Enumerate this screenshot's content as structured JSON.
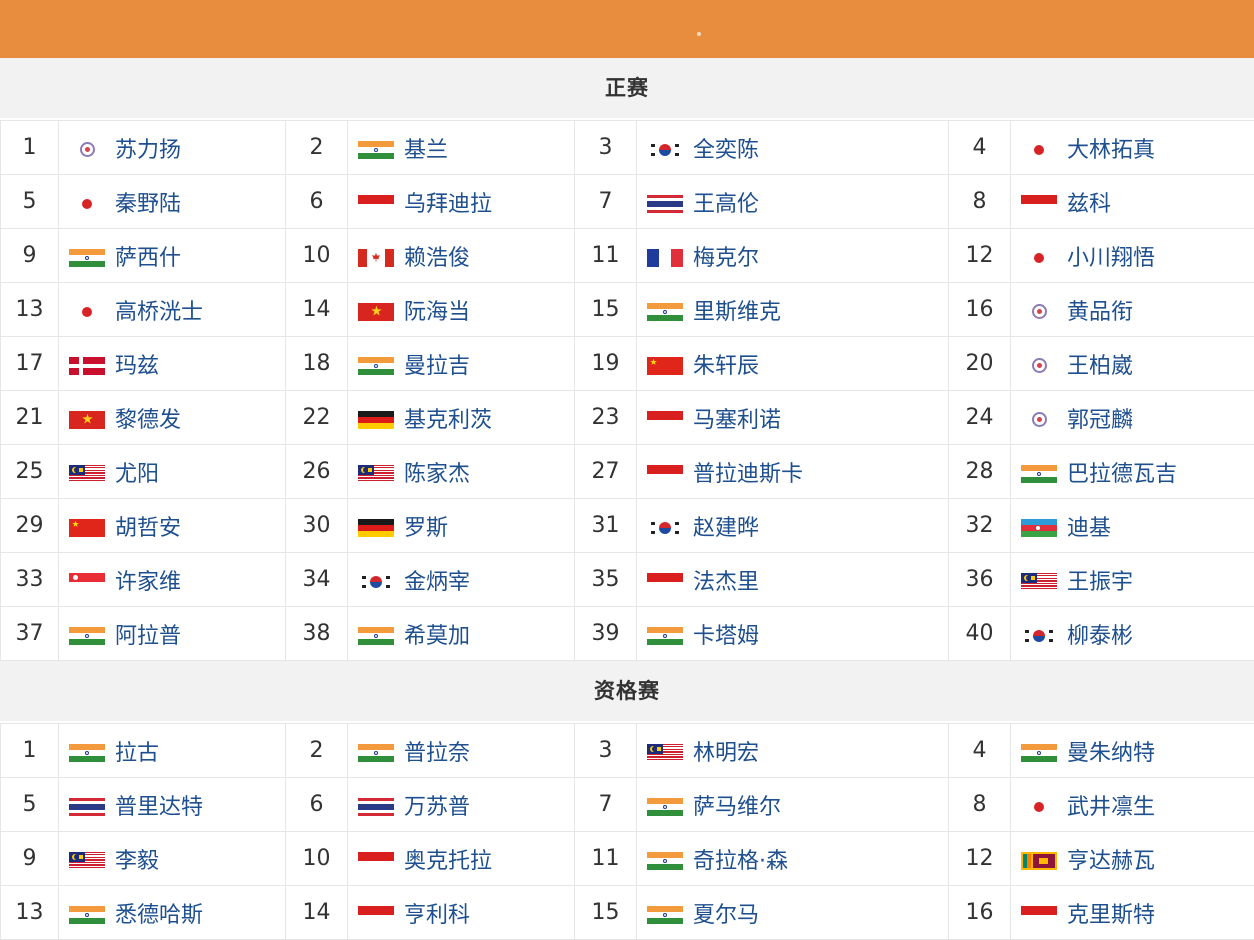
{
  "colors": {
    "header_bar": "#e88c3e",
    "section_bg": "#f2f2f2",
    "player_name": "#1e4f8f",
    "rank_text": "#333333"
  },
  "sections": {
    "main_draw": {
      "title": "正赛",
      "entries": [
        {
          "rank": "1",
          "flag": "chinese-taipei",
          "name": "苏力扬"
        },
        {
          "rank": "2",
          "flag": "india",
          "name": "基兰"
        },
        {
          "rank": "3",
          "flag": "korea",
          "name": "全奕陈"
        },
        {
          "rank": "4",
          "flag": "japan",
          "name": "大林拓真"
        },
        {
          "rank": "5",
          "flag": "japan",
          "name": "秦野陆"
        },
        {
          "rank": "6",
          "flag": "indonesia",
          "name": "乌拜迪拉"
        },
        {
          "rank": "7",
          "flag": "thailand",
          "name": "王高伦"
        },
        {
          "rank": "8",
          "flag": "indonesia",
          "name": "兹科"
        },
        {
          "rank": "9",
          "flag": "india",
          "name": "萨西什"
        },
        {
          "rank": "10",
          "flag": "canada",
          "name": "赖浩俊"
        },
        {
          "rank": "11",
          "flag": "france",
          "name": "梅克尔"
        },
        {
          "rank": "12",
          "flag": "japan",
          "name": "小川翔悟"
        },
        {
          "rank": "13",
          "flag": "japan",
          "name": "高桥洸士"
        },
        {
          "rank": "14",
          "flag": "vietnam",
          "name": "阮海当"
        },
        {
          "rank": "15",
          "flag": "india",
          "name": "里斯维克"
        },
        {
          "rank": "16",
          "flag": "chinese-taipei",
          "name": "黄品衔"
        },
        {
          "rank": "17",
          "flag": "denmark",
          "name": "玛兹"
        },
        {
          "rank": "18",
          "flag": "india",
          "name": "曼拉吉"
        },
        {
          "rank": "19",
          "flag": "china",
          "name": "朱轩辰"
        },
        {
          "rank": "20",
          "flag": "chinese-taipei",
          "name": "王柏崴"
        },
        {
          "rank": "21",
          "flag": "vietnam",
          "name": "黎德发"
        },
        {
          "rank": "22",
          "flag": "germany",
          "name": "基克利茨"
        },
        {
          "rank": "23",
          "flag": "indonesia",
          "name": "马塞利诺"
        },
        {
          "rank": "24",
          "flag": "chinese-taipei",
          "name": "郭冠麟"
        },
        {
          "rank": "25",
          "flag": "malaysia",
          "name": "尤阳"
        },
        {
          "rank": "26",
          "flag": "malaysia",
          "name": "陈家杰"
        },
        {
          "rank": "27",
          "flag": "indonesia",
          "name": "普拉迪斯卡"
        },
        {
          "rank": "28",
          "flag": "india",
          "name": "巴拉德瓦吉"
        },
        {
          "rank": "29",
          "flag": "china",
          "name": "胡哲安"
        },
        {
          "rank": "30",
          "flag": "germany",
          "name": "罗斯"
        },
        {
          "rank": "31",
          "flag": "korea",
          "name": "赵建晔"
        },
        {
          "rank": "32",
          "flag": "azerbaijan",
          "name": "迪基"
        },
        {
          "rank": "33",
          "flag": "singapore",
          "name": "许家维"
        },
        {
          "rank": "34",
          "flag": "korea",
          "name": "金炳宰"
        },
        {
          "rank": "35",
          "flag": "indonesia",
          "name": "法杰里"
        },
        {
          "rank": "36",
          "flag": "malaysia",
          "name": "王振宇"
        },
        {
          "rank": "37",
          "flag": "india",
          "name": "阿拉普"
        },
        {
          "rank": "38",
          "flag": "india",
          "name": "希莫加"
        },
        {
          "rank": "39",
          "flag": "india",
          "name": "卡塔姆"
        },
        {
          "rank": "40",
          "flag": "korea",
          "name": "柳泰彬"
        }
      ]
    },
    "qualification": {
      "title": "资格赛",
      "entries": [
        {
          "rank": "1",
          "flag": "india",
          "name": "拉古"
        },
        {
          "rank": "2",
          "flag": "india",
          "name": "普拉奈"
        },
        {
          "rank": "3",
          "flag": "malaysia",
          "name": "林明宏"
        },
        {
          "rank": "4",
          "flag": "india",
          "name": "曼朱纳特"
        },
        {
          "rank": "5",
          "flag": "thailand",
          "name": "普里达特"
        },
        {
          "rank": "6",
          "flag": "thailand",
          "name": "万苏普"
        },
        {
          "rank": "7",
          "flag": "india",
          "name": "萨马维尔"
        },
        {
          "rank": "8",
          "flag": "japan",
          "name": "武井凛生"
        },
        {
          "rank": "9",
          "flag": "malaysia",
          "name": "李毅"
        },
        {
          "rank": "10",
          "flag": "indonesia",
          "name": "奥克托拉"
        },
        {
          "rank": "11",
          "flag": "india",
          "name": "奇拉格·森"
        },
        {
          "rank": "12",
          "flag": "sri-lanka",
          "name": "亨达赫瓦"
        },
        {
          "rank": "13",
          "flag": "india",
          "name": "悉德哈斯"
        },
        {
          "rank": "14",
          "flag": "indonesia",
          "name": "亨利科"
        },
        {
          "rank": "15",
          "flag": "india",
          "name": "夏尔马"
        },
        {
          "rank": "16",
          "flag": "indonesia",
          "name": "克里斯特"
        }
      ]
    }
  }
}
